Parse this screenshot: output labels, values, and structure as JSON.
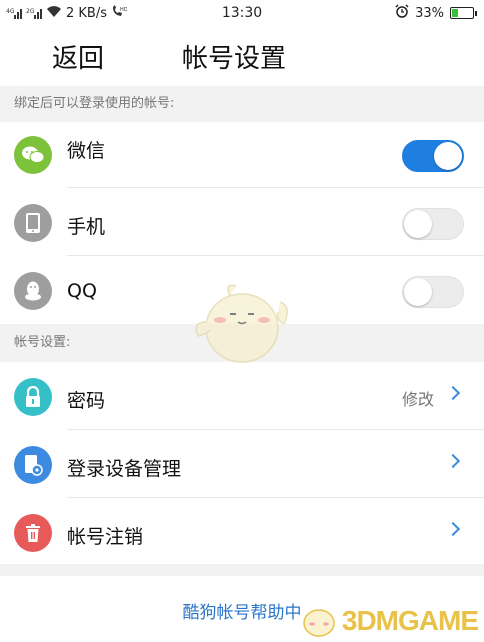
{
  "status_bar": {
    "signal1": "4G",
    "signal2": "2G",
    "speed": "2 KB/s",
    "hd": "HD",
    "time": "13:30",
    "battery_percent": "33%",
    "battery_level": 0.33,
    "icons": [
      "signal-icon",
      "wifi-icon",
      "hd-call-icon",
      "alarm-icon",
      "battery-icon"
    ]
  },
  "nav": {
    "back_label": "返回",
    "title": "帐号设置"
  },
  "bound_section": {
    "header": "绑定后可以登录使用的帐号:",
    "items": [
      {
        "label": "微信",
        "icon": "wechat-icon",
        "icon_color": "#7cc23a",
        "enabled": true
      },
      {
        "label": "手机",
        "icon": "phone-icon",
        "icon_color": "#9e9e9e",
        "enabled": false
      },
      {
        "label": "QQ",
        "icon": "qq-icon",
        "icon_color": "#9e9e9e",
        "enabled": false
      }
    ]
  },
  "account_section": {
    "header": "帐号设置:",
    "items": [
      {
        "label": "密码",
        "icon": "lock-icon",
        "icon_color": "#35c0c8",
        "action": "修改"
      },
      {
        "label": "登录设备管理",
        "icon": "device-settings-icon",
        "icon_color": "#3d8be0"
      },
      {
        "label": "帐号注销",
        "icon": "trash-icon",
        "icon_color": "#e85a5a"
      }
    ]
  },
  "help_link": "酷狗帐号帮助中",
  "watermark": {
    "text": "3DMGAME"
  },
  "colors": {
    "accent": "#1f7fe0",
    "link": "#2b76c9",
    "section_bg": "#f2f2f2"
  }
}
